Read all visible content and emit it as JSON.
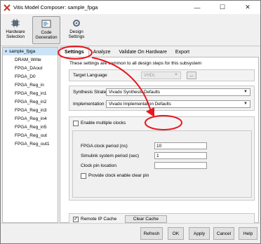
{
  "window": {
    "title": "Vitis Model Composer: sample_fpga",
    "controls": {
      "minimize": "—",
      "maximize": "☐",
      "close": "✕"
    }
  },
  "toolbar": {
    "hardware_selection": "Hardware Selection",
    "code_generation": "Code Generation",
    "design_settings": "Design Settings"
  },
  "tree": {
    "root": "sample_fpga",
    "items": [
      "DRAM_Write",
      "FPGA_DAout",
      "FPGA_D0",
      "FPGA_Reg_in",
      "FPGA_Reg_in1",
      "FPGA_Reg_in2",
      "FPGA_Reg_in3",
      "FPGA_Reg_in4",
      "FPGA_Reg_in5",
      "FPGA_Reg_out",
      "FPGA_Reg_out1"
    ]
  },
  "tabs": [
    "Settings",
    "Analyze",
    "Validate On Hardware",
    "Export"
  ],
  "settings": {
    "description": "These settings are common to all design steps for this subsystem",
    "target_language_label": "Target Language",
    "target_language_value": "VHDL",
    "browse_label": "...",
    "synthesis_label": "Synthesis Strategy",
    "synthesis_value": "Vivado Synthesis Defaults",
    "implementation_label": "Implementation Strategy",
    "implementation_value": "Vivado Implementation Defaults",
    "multiple_clocks_label": "Enable multiple clocks",
    "fpga_clock_label": "FPGA clock period (ns)",
    "fpga_clock_value": "10",
    "simulink_period_label": "Simulink system period (sec)",
    "simulink_period_value": "1",
    "clock_pin_label": "Clock pin location",
    "clock_pin_value": "",
    "clear_pin_label": "Provide clock enable clear pin",
    "remote_ip_label": "Remote IP Cache",
    "clear_cache_label": "Clear Cache"
  },
  "buttons": {
    "refresh": "Refresh",
    "ok": "OK",
    "apply": "Apply",
    "cancel": "Cancel",
    "help": "Help"
  },
  "colors": {
    "annotation": "#e8171e",
    "selection": "#cce3f7"
  }
}
